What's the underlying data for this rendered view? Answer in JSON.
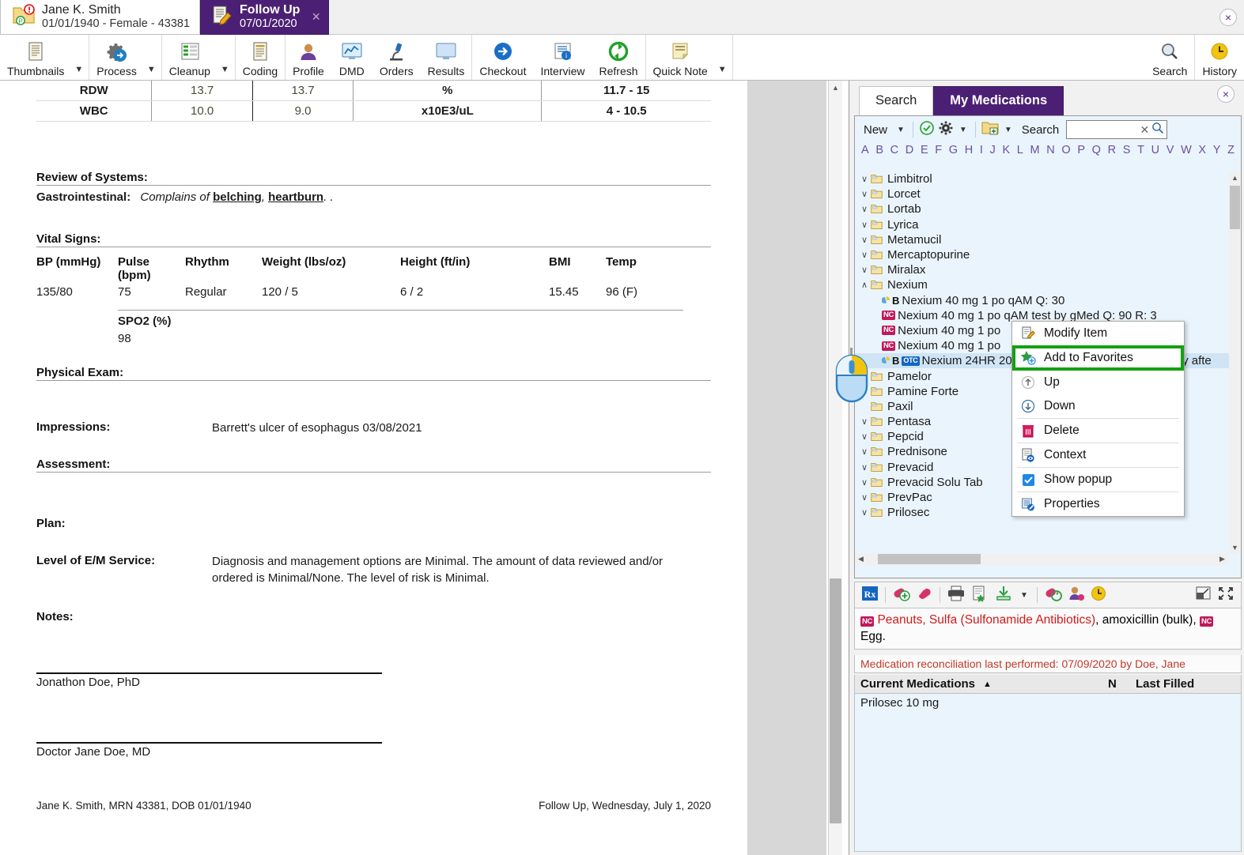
{
  "patient_tab": {
    "name": "Jane K. Smith",
    "details": "01/01/1940 - Female - 43381",
    "folder_icon": "patient-folder-alert-icon"
  },
  "doc_tab": {
    "title": "Follow Up",
    "date": "07/01/2020",
    "close": "×"
  },
  "window": {
    "close": "×"
  },
  "ribbon": {
    "items": [
      {
        "label": "Thumbnails",
        "icon": "document-thumbnails-icon",
        "caret": true
      },
      {
        "label": "Process",
        "icon": "gear-arrow-icon",
        "caret": true
      },
      {
        "label": "Cleanup",
        "icon": "cleanup-list-icon",
        "caret": true
      },
      {
        "label": "Coding",
        "icon": "coding-document-icon",
        "caret": false
      },
      {
        "label": "Profile",
        "icon": "person-profile-icon",
        "caret": false
      },
      {
        "label": "DMD",
        "icon": "monitor-chart-icon",
        "caret": false
      },
      {
        "label": "Orders",
        "icon": "microscope-icon",
        "caret": false
      },
      {
        "label": "Results",
        "icon": "monitor-results-icon",
        "caret": false
      },
      {
        "label": "Checkout",
        "icon": "arrow-right-circle-icon",
        "caret": false
      },
      {
        "label": "Interview",
        "icon": "interview-info-icon",
        "caret": false
      },
      {
        "label": "Refresh",
        "icon": "refresh-circle-icon",
        "caret": false
      },
      {
        "label": "Quick Note",
        "icon": "note-icon",
        "caret": true
      }
    ],
    "right_items": [
      {
        "label": "Search",
        "icon": "magnifier-icon"
      },
      {
        "label": "History",
        "icon": "clock-icon"
      }
    ]
  },
  "document": {
    "labs": [
      {
        "name": "RDW",
        "v1": "13.7",
        "v2": "13.7",
        "unit": "%",
        "range": "11.7 - 15"
      },
      {
        "name": "WBC",
        "v1": "10.0",
        "v2": "9.0",
        "unit": "x10E3/uL",
        "range": "4 - 10.5"
      }
    ],
    "ros_heading": "Review of Systems:",
    "ros_label": "Gastrointestinal:",
    "ros_prefix": "Complains of ",
    "ros_t1": "belching",
    "ros_mid": ", ",
    "ros_t2": "heartburn",
    "ros_suffix": ". .",
    "vitals_heading": "Vital Signs:",
    "vitals_headers": [
      "BP (mmHg)",
      "Pulse (bpm)",
      "Rhythm",
      "Weight (lbs/oz)",
      "Height (ft/in)",
      "BMI",
      "Temp"
    ],
    "vitals_values": [
      "135/80",
      "75",
      "Regular",
      "120 / 5",
      "6 / 2",
      "15.45",
      "96 (F)"
    ],
    "spo2_header": "SPO2 (%)",
    "spo2_value": "98",
    "physical_exam_heading": "Physical Exam:",
    "impressions_label": "Impressions:",
    "impressions_value": "Barrett's ulcer of esophagus 03/08/2021",
    "assessment_heading": "Assessment:",
    "plan_label": "Plan:",
    "em_label": "Level of E/M Service:",
    "em_value": "Diagnosis and management options are Minimal. The amount of data reviewed and/or ordered is Minimal/None. The level of risk is Minimal.",
    "notes_label": "Notes:",
    "sig1": "Jonathon Doe, PhD",
    "sig2": "Doctor Jane Doe, MD",
    "footer_left": "Jane K. Smith, MRN 43381, DOB 01/01/1940",
    "footer_right": "Follow Up, Wednesday, July 1, 2020"
  },
  "right_panel": {
    "tabs": [
      {
        "label": "Search",
        "active": false
      },
      {
        "label": "My Medications",
        "active": true
      }
    ],
    "close": "×",
    "toolbar": {
      "new_label": "New",
      "search_label": "Search",
      "search_value": "",
      "check_icon": "check-circle-icon",
      "gear_icon": "gear-icon",
      "newfolder_icon": "new-folder-icon",
      "clear_icon": "clear-x-icon",
      "magnifier_icon": "magnifier-icon"
    },
    "alphabet": [
      "A",
      "B",
      "C",
      "D",
      "E",
      "F",
      "G",
      "H",
      "I",
      "J",
      "K",
      "L",
      "M",
      "N",
      "O",
      "P",
      "Q",
      "R",
      "S",
      "T",
      "U",
      "V",
      "W",
      "X",
      "Y",
      "Z"
    ],
    "tree": [
      {
        "label": "Limbitrol",
        "type": "folder",
        "expanded": false
      },
      {
        "label": "Lorcet",
        "type": "folder",
        "expanded": false
      },
      {
        "label": "Lortab",
        "type": "folder",
        "expanded": false
      },
      {
        "label": "Lyrica",
        "type": "folder",
        "expanded": false
      },
      {
        "label": "Metamucil",
        "type": "folder",
        "expanded": false
      },
      {
        "label": "Mercaptopurine",
        "type": "folder",
        "expanded": false
      },
      {
        "label": "Miralax",
        "type": "folder",
        "expanded": false
      },
      {
        "label": "Nexium",
        "type": "folder",
        "expanded": true
      },
      {
        "label": "Nexium 40 mg 1 po qAM Q: 30",
        "type": "child",
        "badge": "B"
      },
      {
        "label": "Nexium 40 mg 1 po qAM test by gMed Q: 90 R: 3",
        "type": "child",
        "badge": "NC"
      },
      {
        "label": "Nexium 40 mg 1 po",
        "type": "child",
        "badge": "NC"
      },
      {
        "label": "Nexium 40 mg 1 po",
        "type": "child",
        "badge": "NC"
      },
      {
        "label": "Nexium 24HR 20 m",
        "type": "child",
        "badge": "B-OTC",
        "selected": true,
        "tail": "day afte"
      },
      {
        "label": "Pamelor",
        "type": "folder",
        "expanded": null
      },
      {
        "label": "Pamine Forte",
        "type": "folder",
        "expanded": null
      },
      {
        "label": "Paxil",
        "type": "folder",
        "expanded": null
      },
      {
        "label": "Pentasa",
        "type": "folder",
        "expanded": false
      },
      {
        "label": "Pepcid",
        "type": "folder",
        "expanded": false
      },
      {
        "label": "Prednisone",
        "type": "folder",
        "expanded": false
      },
      {
        "label": "Prevacid",
        "type": "folder",
        "expanded": false
      },
      {
        "label": "Prevacid Solu Tab",
        "type": "folder",
        "expanded": false
      },
      {
        "label": "PrevPac",
        "type": "folder",
        "expanded": false
      },
      {
        "label": "Prilosec",
        "type": "folder",
        "expanded": false
      }
    ],
    "context_menu": [
      {
        "label": "Modify Item",
        "icon": "modify-document-icon",
        "highlighted": false
      },
      {
        "label": "Add to Favorites",
        "icon": "star-plus-icon",
        "highlighted": true
      },
      {
        "label": "Up",
        "icon": "arrow-up-circle-icon",
        "highlighted": false
      },
      {
        "label": "Down",
        "icon": "arrow-down-circle-icon",
        "highlighted": false
      },
      {
        "label": "Delete",
        "icon": "trash-icon",
        "highlighted": false
      },
      {
        "label": "Context",
        "icon": "context-eye-icon",
        "highlighted": false
      },
      {
        "label": "Show popup",
        "icon": "checkbox-checked-icon",
        "highlighted": false
      },
      {
        "label": "Properties",
        "icon": "properties-icon",
        "highlighted": false
      }
    ],
    "highlight_color": "#15a013",
    "med_actions": [
      {
        "icon": "rx-icon"
      },
      {
        "icon": "add-pill-icon"
      },
      {
        "icon": "pill-icon"
      },
      {
        "icon": "print-icon"
      },
      {
        "icon": "document-star-icon"
      },
      {
        "icon": "download-icon"
      },
      {
        "icon": "refresh-pill-icon"
      },
      {
        "icon": "patient-pill-icon"
      },
      {
        "icon": "clock-icon"
      },
      {
        "icon": "collapse-icon"
      },
      {
        "icon": "expand-icon"
      }
    ],
    "allergies": {
      "badge1": "NC",
      "t1": "Peanuts, Sulfa (Sulfonamide Antibiotics)",
      "t2": ", amoxicillin (bulk), ",
      "badge2": "NC",
      "t3": "Egg."
    },
    "med_reconciliation": "Medication reconciliation last performed: 07/09/2020 by Doe, Jane",
    "current_meds": {
      "col_name": "Current Medications",
      "sort_arrow": "▲",
      "col_n": "N",
      "col_last_filled": "Last Filled",
      "rows": [
        {
          "name": "Prilosec 10 mg",
          "n": "",
          "last_filled": ""
        }
      ]
    }
  }
}
